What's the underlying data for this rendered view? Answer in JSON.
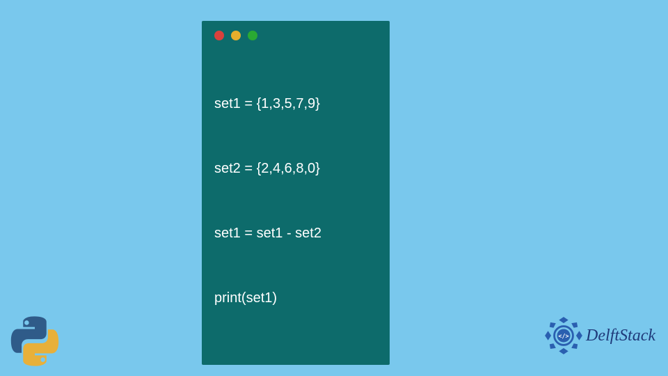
{
  "code": {
    "lines": [
      "set1 = {1,3,5,7,9}",
      "set2 = {2,4,6,8,0}",
      "set1 = set1 - set2",
      "print(set1)"
    ]
  },
  "brand": {
    "name": "DelftStack"
  },
  "colors": {
    "background": "#79c8ed",
    "code_window_bg": "#0d6b6b",
    "code_text": "#ffffff",
    "brand_text": "#1f3a7a",
    "dot_red": "#d9413c",
    "dot_yellow": "#e8ae2c",
    "dot_green": "#2aa933"
  }
}
